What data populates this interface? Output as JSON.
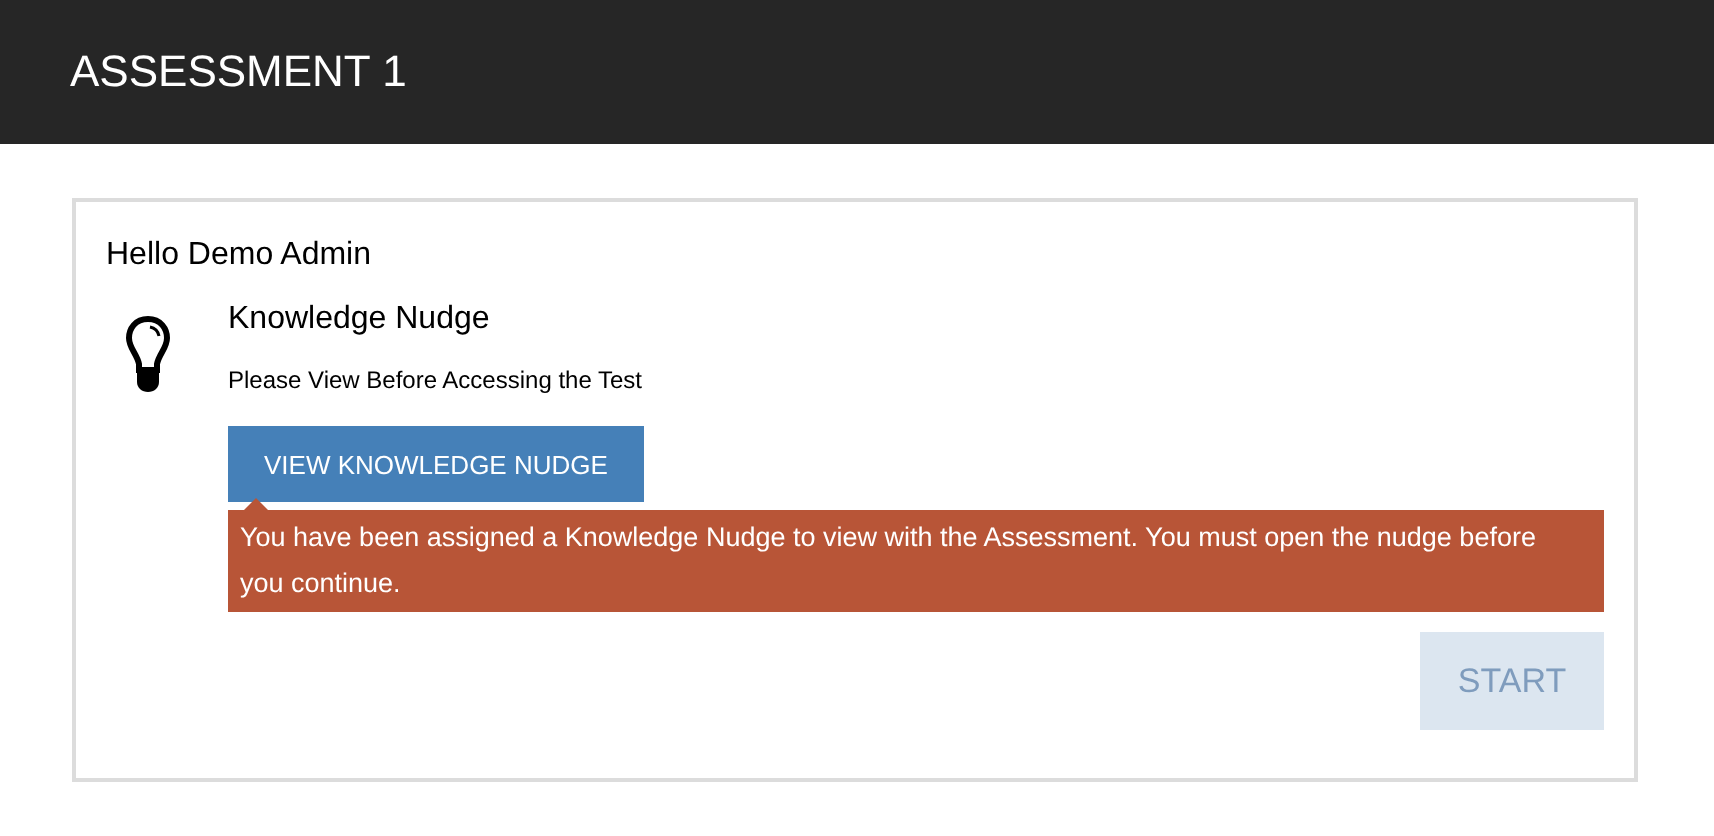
{
  "header": {
    "title": "ASSESSMENT 1"
  },
  "card": {
    "greeting": "Hello Demo Admin",
    "nudge": {
      "title": "Knowledge Nudge",
      "subtitle": "Please View Before Accessing the Test",
      "button": "VIEW KNOWLEDGE NUDGE"
    },
    "error": "You have been assigned a Knowledge Nudge to view with the Assessment. You must open the nudge before you continue.",
    "start_button": {
      "label": "START",
      "disabled": true
    }
  }
}
